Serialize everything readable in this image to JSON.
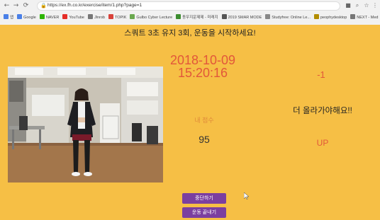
{
  "browser": {
    "url": "https://ex.fh.co.kr/exercise/item/1.php?page=1",
    "bookmarks": [
      {
        "label": "앱",
        "color": "#4a80e8"
      },
      {
        "label": "Google",
        "color": "#4a80e8"
      },
      {
        "label": "NAVER",
        "color": "#2db400"
      },
      {
        "label": "YouTube",
        "color": "#e52d27"
      },
      {
        "label": "Jlnrob",
        "color": "#777777"
      },
      {
        "label": "TOPIK",
        "color": "#d8423a"
      },
      {
        "label": "Gulbo Cyber Lecture",
        "color": "#6aa84f"
      },
      {
        "label": "동우지운제제 - 미래지",
        "color": "#3c8d2f"
      },
      {
        "label": "2019 SMAR MODE",
        "color": "#555555"
      },
      {
        "label": "Studyfree: Online Le...",
        "color": "#888888"
      },
      {
        "label": "peophydesktop",
        "color": "#b28d00"
      },
      {
        "label": "NEXT - Med",
        "color": "#777777"
      }
    ]
  },
  "app": {
    "heading": "스쿼트 3초 유지 3회, 운동을 시작하세요!",
    "date": "2018-10-09",
    "time": "15:20:16",
    "delta": "-1",
    "score_label": "내 점수",
    "score": "95",
    "message": "더 올라가야해요!!",
    "direction": "UP",
    "buttons": {
      "stop": "중단하기",
      "end": "운동 끝내기"
    }
  },
  "colors": {
    "background": "#f6bf45",
    "accent": "#e2573a",
    "button": "#7b3fa0"
  }
}
